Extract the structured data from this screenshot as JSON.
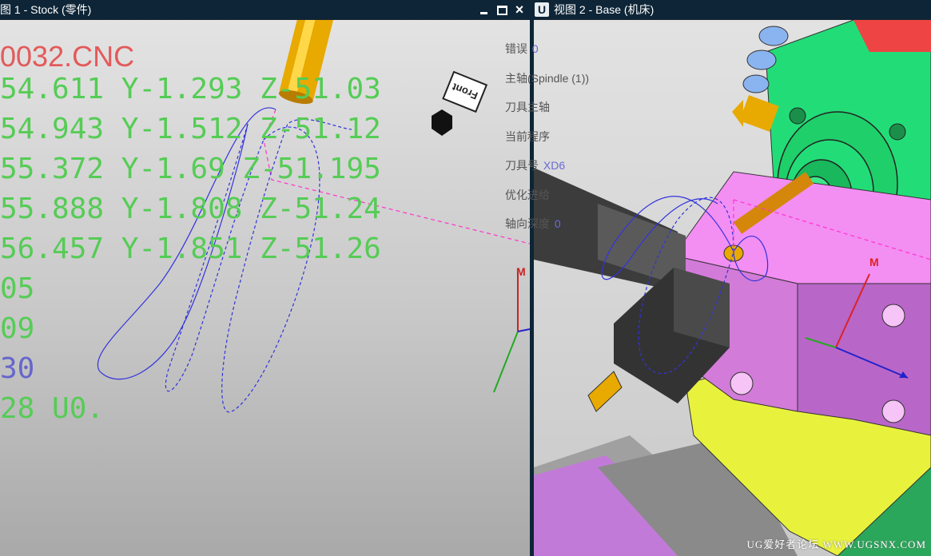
{
  "view1": {
    "title": "图 1 - Stock (零件)",
    "window_controls": {
      "minimize": "_",
      "maximize": "□",
      "close": "×"
    },
    "nc_program": {
      "filename": "0032.CNC",
      "lines": [
        "54.611 Y-1.293 Z-51.03",
        "54.943 Y-1.512 Z-51.12",
        "55.372 Y-1.69 Z-51.195",
        "55.888 Y-1.808 Z-51.24",
        "56.457 Y-1.851 Z-51.26",
        "05",
        "09",
        "30",
        "28 U0."
      ]
    },
    "orientation_label": "Front",
    "axis_label": "M"
  },
  "view2": {
    "title": "视图 2 - Base (机床)",
    "logo": "U",
    "axis_label": "M",
    "watermark": "UG爱好者论坛 WWW.UGSNX.COM"
  },
  "info_panel": {
    "rows": [
      {
        "label": "错误",
        "value": "0"
      },
      {
        "label": "主轴",
        "value": "(Spindle (1))"
      },
      {
        "label": "刀具主轴",
        "value": ""
      },
      {
        "label": "当前程序",
        "value": ""
      },
      {
        "label": "刀具号",
        "value": "XD6"
      },
      {
        "label": "优化进给",
        "value": ""
      },
      {
        "label": "轴向深度",
        "value": "0"
      }
    ]
  },
  "colors": {
    "titlebar": "#0d2537",
    "nc_text_green": "#55cc55",
    "nc_filename_red": "#e35a5a",
    "nc_text_blue": "#6666cc",
    "info_value": "#6a6ad6",
    "toolpath": "#3333dd",
    "rapid_path": "#ff33cc",
    "tool_gold": "#e8a900",
    "stock_magenta": "#f27ff2",
    "housing_green": "#22dd77",
    "base_yellow": "#e8f23c"
  }
}
